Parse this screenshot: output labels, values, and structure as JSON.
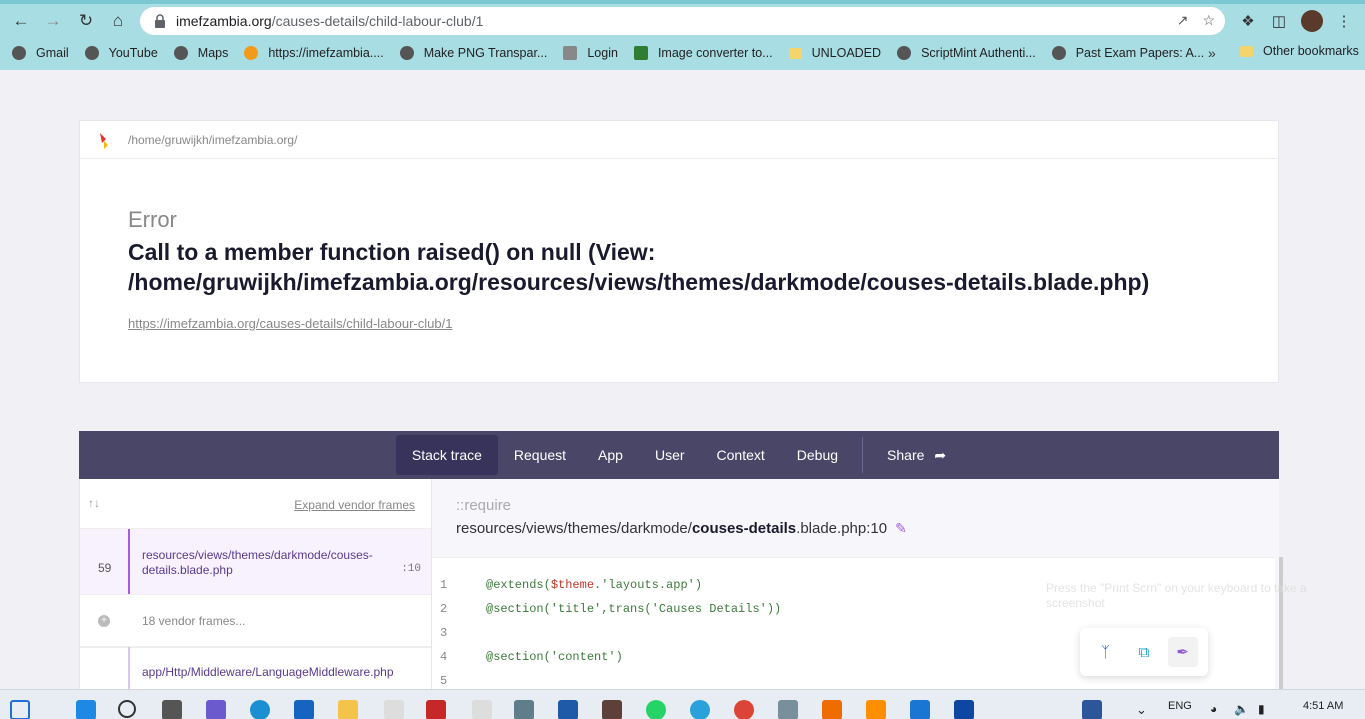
{
  "browser": {
    "url_host": "imefzambia.org",
    "url_path": "/causes-details/child-labour-club/1",
    "bookmarks": [
      {
        "label": "Gmail",
        "color": "#555"
      },
      {
        "label": "YouTube",
        "color": "#555"
      },
      {
        "label": "Maps",
        "color": "#555"
      },
      {
        "label": "https://imefzambia....",
        "color": "#f29a1a"
      },
      {
        "label": "Make PNG Transpar...",
        "color": "#555"
      },
      {
        "label": "Login",
        "color": "#888"
      },
      {
        "label": "Image converter to...",
        "color": "#2e7d32"
      },
      {
        "label": "UNLOADED",
        "color": "#f3d56b"
      },
      {
        "label": "ScriptMint Authenti...",
        "color": "#555"
      },
      {
        "label": "Past Exam Papers: A...",
        "color": "#555"
      }
    ],
    "more": "»",
    "other_bookmarks": "Other bookmarks"
  },
  "error_page": {
    "path": "/home/gruwijkh/imefzambia.org/",
    "label": "Error",
    "message": "Call to a member function raised() on null (View: /home/gruwijkh/imefzambia.org/resources/views/themes/darkmode/couses-details.blade.php)",
    "url": "https://imefzambia.org/causes-details/child-labour-club/1"
  },
  "tabs": {
    "stack_trace": "Stack trace",
    "request": "Request",
    "app": "App",
    "user": "User",
    "context": "Context",
    "debug": "Debug",
    "share": "Share"
  },
  "frames": {
    "expand": "Expand vendor frames",
    "active_num": "59",
    "active_file": "resources/views/themes/darkmode/couses-details.blade.php",
    "active_line": ":10",
    "vendor": "18 vendor frames...",
    "next_file": "app/Http/Middleware/LanguageMiddleware.php"
  },
  "source": {
    "label": "::require",
    "file_prefix": "resources/views/themes/darkmode/",
    "file_bold": "couses-details",
    "file_suffix": ".blade.php:10",
    "lines": [
      {
        "n": "1",
        "pre": "@extends(",
        "var": "$theme",
        "post": ".'layouts.app')"
      },
      {
        "n": "2",
        "pre": "@section('title',trans('Causes Details'))",
        "var": "",
        "post": ""
      },
      {
        "n": "3",
        "pre": "",
        "var": "",
        "post": ""
      },
      {
        "n": "4",
        "pre": "@section('content')",
        "var": "",
        "post": ""
      },
      {
        "n": "5",
        "pre": "",
        "var": "",
        "post": ""
      }
    ]
  },
  "overlay": {
    "toast": "Press the \"Print Scrn\" on your keyboard to take a screenshot"
  },
  "taskbar": {
    "lang": "ENG",
    "time": "4:51 AM"
  }
}
